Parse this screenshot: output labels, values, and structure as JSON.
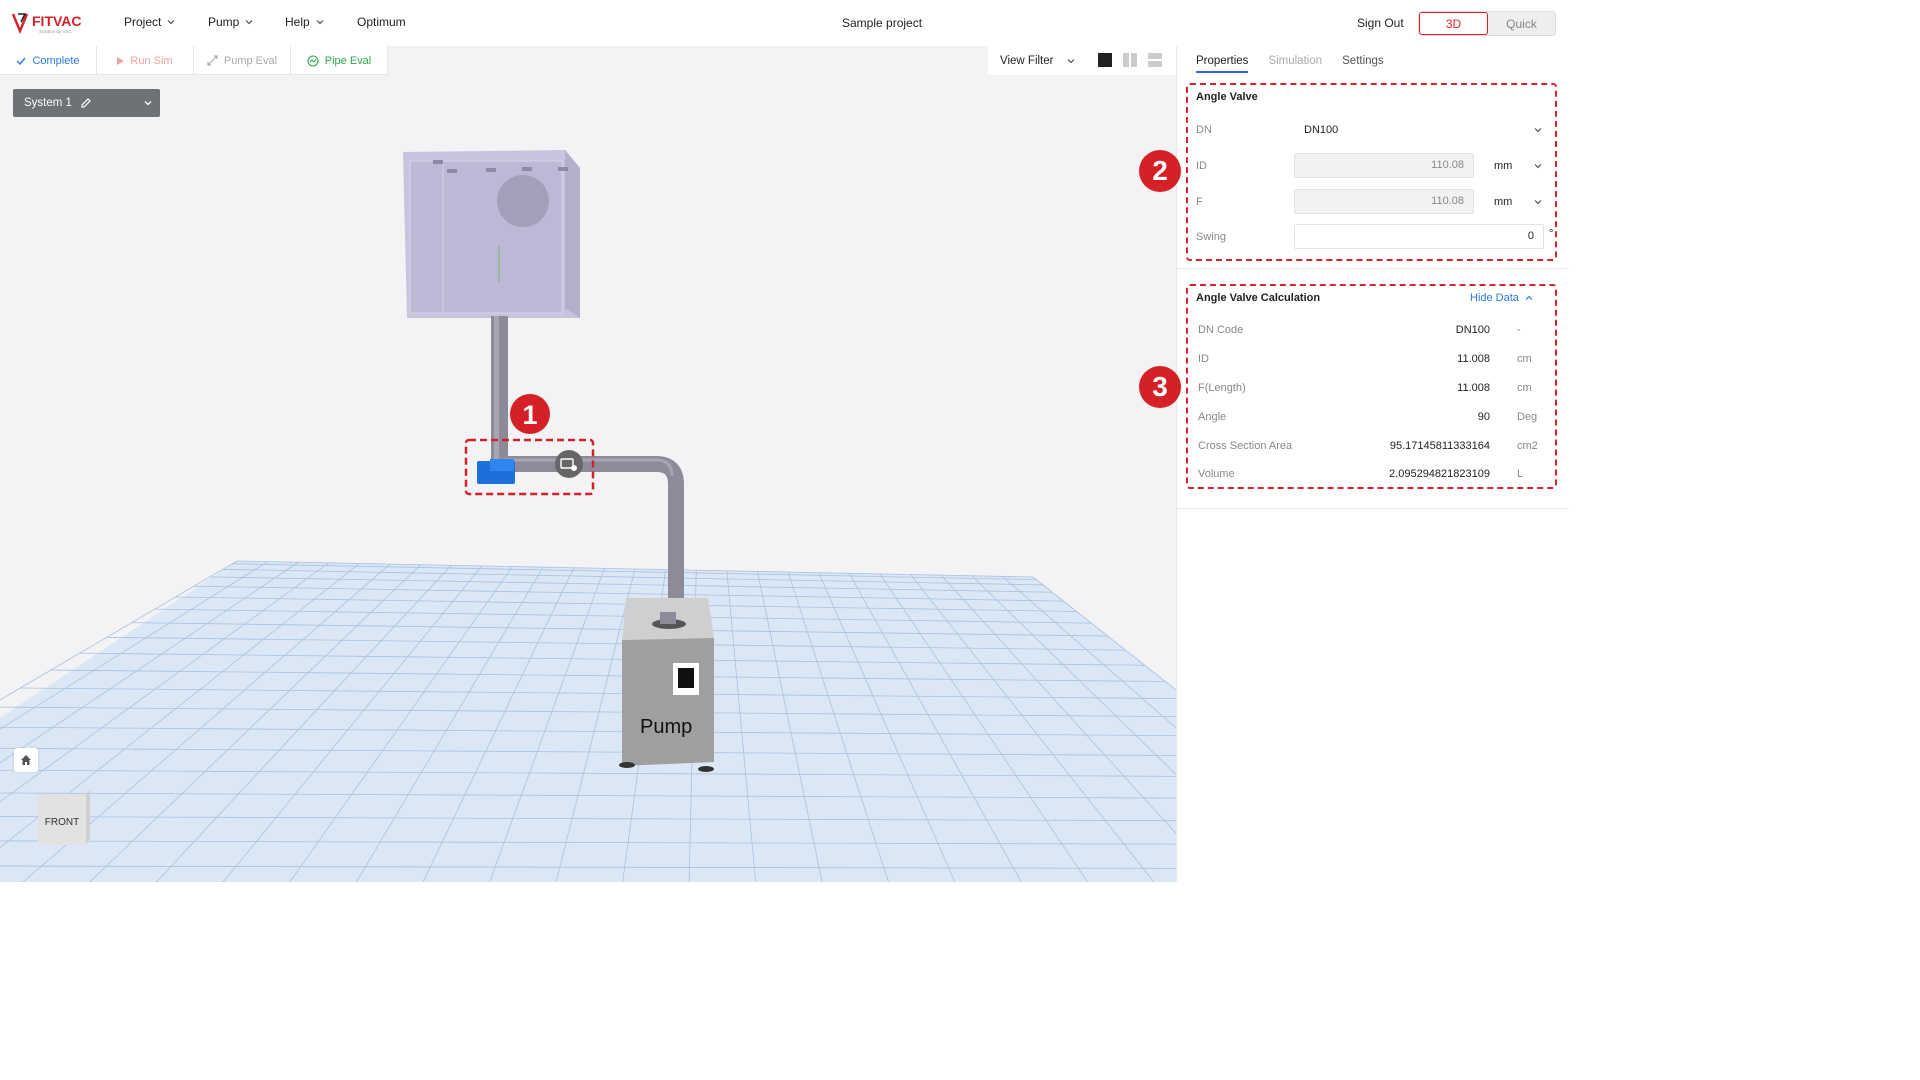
{
  "app": {
    "brand_name": "FITVAC",
    "brand_tagline": "Solution by VSC"
  },
  "menu": {
    "project": "Project",
    "pump": "Pump",
    "help": "Help",
    "optimum": "Optimum"
  },
  "header": {
    "project_title": "Sample project",
    "sign_out": "Sign Out",
    "view_3d": "3D",
    "view_quick": "Quick"
  },
  "toolbar": {
    "complete": "Complete",
    "run_sim": "Run Sim",
    "pump_eval": "Pump Eval",
    "pipe_eval": "Pipe Eval",
    "view_filter": "View Filter"
  },
  "system": {
    "selected": "System 1"
  },
  "scene": {
    "pump_label": "Pump",
    "nav_cube_face": "FRONT"
  },
  "annotations": {
    "badge1": "1",
    "badge2": "2",
    "badge3": "3"
  },
  "panel": {
    "tabs": {
      "properties": "Properties",
      "simulation": "Simulation",
      "settings": "Settings"
    },
    "props": {
      "title": "Angle Valve",
      "dn_label": "DN",
      "dn_value": "DN100",
      "id_label": "ID",
      "id_value": "110.08",
      "id_unit": "mm",
      "f_label": "F",
      "f_value": "110.08",
      "f_unit": "mm",
      "swing_label": "Swing",
      "swing_value": "0",
      "swing_unit": "°"
    },
    "calc": {
      "title": "Angle Valve Calculation",
      "hide_data": "Hide Data",
      "rows": [
        {
          "label": "DN Code",
          "value": "DN100",
          "unit": "-"
        },
        {
          "label": "ID",
          "value": "11.008",
          "unit": "cm"
        },
        {
          "label": "F(Length)",
          "value": "11.008",
          "unit": "cm"
        },
        {
          "label": "Angle",
          "value": "90",
          "unit": "Deg"
        },
        {
          "label": "Cross Section Area",
          "value": "95.17145811333164",
          "unit": "cm2"
        },
        {
          "label": "Volume",
          "value": "2.095294821823109",
          "unit": "L"
        }
      ]
    }
  },
  "colors": {
    "accent_red": "#d42026",
    "brand_blue": "#2a6fdb",
    "complete_blue": "#2a7ae2",
    "pipe_green": "#2aa84a"
  }
}
